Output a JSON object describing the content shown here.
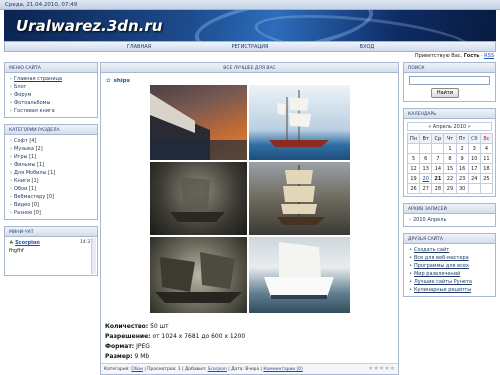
{
  "topbar": {
    "datetime": "Среда, 21.04.2010, 07:49"
  },
  "site": {
    "title": "Uralwarez.3dn.ru"
  },
  "nav": {
    "items": [
      "ГЛАВНАЯ",
      "РЕГИСТРАЦИЯ",
      "ВХОД"
    ]
  },
  "welcome": {
    "text": "Приветствую Вас,",
    "user": "Гость",
    "rss": "RSS"
  },
  "left": {
    "menu": {
      "title": "МЕНЮ САЙТА",
      "items": [
        "Главная страница",
        "Блог",
        "Форум",
        "Фотоальбомы",
        "Гостевая книга"
      ]
    },
    "categories": {
      "title": "КАТЕГОРИИ РАЗДЕЛА",
      "items": [
        {
          "name": "Софт",
          "count": "[4]"
        },
        {
          "name": "Музыка",
          "count": "[2]"
        },
        {
          "name": "Игры",
          "count": "[1]"
        },
        {
          "name": "Фильмы",
          "count": "[1]"
        },
        {
          "name": "Для Мобилы",
          "count": "[1]"
        },
        {
          "name": "Книги",
          "count": "[1]"
        },
        {
          "name": "Обои",
          "count": "[1]"
        },
        {
          "name": "Вебмастеру",
          "count": "[0]"
        },
        {
          "name": "Видео",
          "count": "[0]"
        },
        {
          "name": "Разное",
          "count": "[0]"
        }
      ]
    },
    "chat": {
      "title": "МИНИ-ЧАТ",
      "user": "Scorpion",
      "time": "14:37",
      "message": "fhgfhf"
    }
  },
  "center": {
    "title": "ВСЕ ЛУЧШЕЕ ДЛЯ ВАС",
    "post_title": "ships",
    "details": {
      "qty_label": "Количество:",
      "qty": "50 шт",
      "res_label": "Разрешение:",
      "res": "от 1024 x 7681 до 600 x 1200",
      "fmt_label": "Формат:",
      "fmt": "JPEG",
      "size_label": "Размер:",
      "size": "9 Mb"
    },
    "meta": {
      "category_label": "Категория:",
      "category": "Обои",
      "views": "Просмотров: 1",
      "added_label": "Добавил:",
      "added_by": "Scorpion",
      "date": "Дата: Вчера",
      "comments": "Комментарии (0)"
    }
  },
  "right": {
    "search": {
      "title": "ПОИСК",
      "button": "Найти"
    },
    "calendar": {
      "title": "КАЛЕНДАРЬ",
      "month": "« Апрель 2010 »",
      "weekdays": [
        "Пн",
        "Вт",
        "Ср",
        "Чт",
        "Пт",
        "Сб",
        "Вс"
      ],
      "rows": [
        [
          "",
          "",
          "",
          "1",
          "2",
          "3",
          "4"
        ],
        [
          "5",
          "6",
          "7",
          "8",
          "9",
          "10",
          "11"
        ],
        [
          "12",
          "13",
          "14",
          "15",
          "16",
          "17",
          "18"
        ],
        [
          "19",
          "20",
          "21",
          "22",
          "23",
          "24",
          "25"
        ],
        [
          "26",
          "27",
          "28",
          "29",
          "30",
          "",
          ""
        ]
      ]
    },
    "archive": {
      "title": "АРХИВ ЗАПИСЕЙ",
      "items": [
        "2010 Апрель"
      ]
    },
    "friends": {
      "title": "ДРУЗЬЯ САЙТА",
      "items": [
        "Создать сайт",
        "Все для веб-мастера",
        "Программы для всех",
        "Мир развлечений",
        "Лучшие сайты Рунета",
        "Кулинарные рецепты"
      ]
    }
  }
}
